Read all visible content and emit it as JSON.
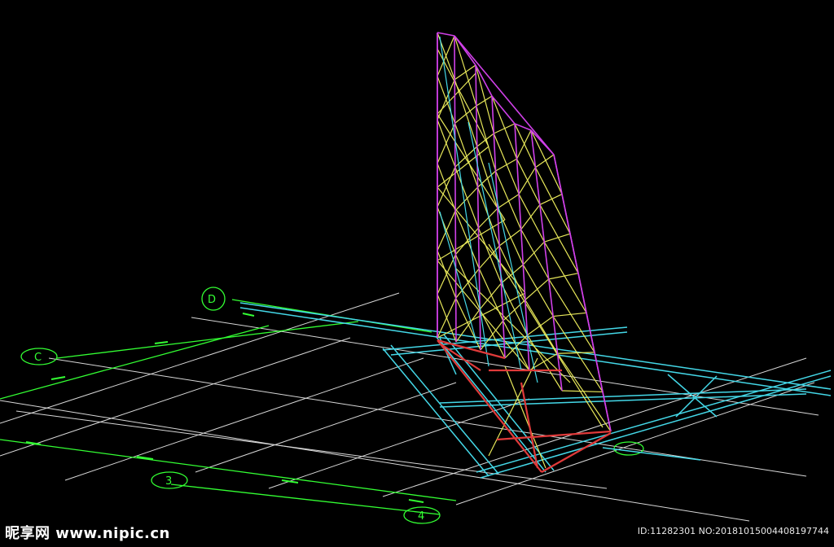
{
  "drawing": {
    "grid_axis_labels": [
      "D",
      "C",
      "3",
      "4"
    ],
    "colors": {
      "background": "#000000",
      "grid": "#d8d8d8",
      "axis": "#33ff33",
      "beam": "#44d8e8",
      "truss_chord": "#d040e8",
      "truss_web": "#e8e85a",
      "truss_base": "#e03a3a"
    }
  },
  "watermark": {
    "brand": "昵享网 www.nipic.cn",
    "id_text": "ID:11282301 NO:20181015004408197744"
  }
}
